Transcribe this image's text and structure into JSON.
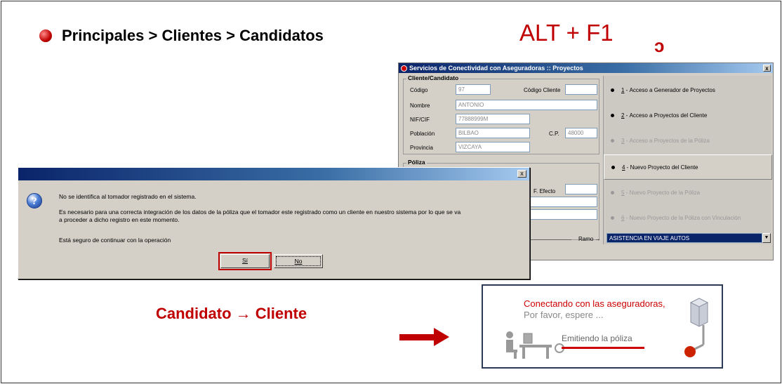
{
  "slide": {
    "breadcrumb": "Principales > Clientes > Candidatos",
    "shortcut": "ALT + F1",
    "transition_label": "Candidato → Cliente"
  },
  "proyectos_window": {
    "title": "Servicios de Conectividad con Aseguradoras :: Proyectos",
    "cliente_group": "Cliente/Candidato",
    "fields": {
      "codigo_label": "Código",
      "codigo_value": "97",
      "codigo_cliente_label": "Código Cliente",
      "codigo_cliente_value": "",
      "nombre_label": "Nombre",
      "nombre_value": "ANTONIO",
      "nif_label": "NIF/CIF",
      "nif_value": "77888999M",
      "poblacion_label": "Población",
      "poblacion_value": "BILBAO",
      "cp_label": "C.P.",
      "cp_value": "48000",
      "provincia_label": "Provincia",
      "provincia_value": "VIZCAYA"
    },
    "poliza_group": "Póliza",
    "f_efecto_label": "F. Efecto",
    "ramo_label": "Ramo",
    "ramo_value": "ASISTENCIA EN VIAJE AUTOS",
    "menu": [
      {
        "num": "1",
        "label": "Acceso a Generador de Proyectos",
        "enabled": true
      },
      {
        "num": "2",
        "label": "Acceso a Proyectos del Cliente",
        "enabled": true
      },
      {
        "num": "3",
        "label": "Acceso a Proyectos de la Póliza",
        "enabled": false
      },
      {
        "num": "4",
        "label": "Nuevo Proyecto del Cliente",
        "enabled": true
      },
      {
        "num": "5",
        "label": "Nuevo Proyecto de la Póliza",
        "enabled": false
      },
      {
        "num": "6",
        "label": "Nuevo Proyecto de la Póliza con Vinculación",
        "enabled": false
      }
    ]
  },
  "dialog": {
    "line1": "No se identifica al tomador registrado en el sistema.",
    "line2a": "Es necesario para una correcta integración de los datos de la póliza que el tomador este registrado como un cliente en nuestro sistema por lo que se va",
    "line2b": "a proceder a dicho registro en este momento.",
    "line3": "Está seguro de continuar con la operación",
    "yes_button": "Sí",
    "no_button": "No"
  },
  "connecting_panel": {
    "line1": "Conectando con las aseguradoras,",
    "line2": "Por favor, espere ...",
    "status": "Emitiendo la póliza"
  },
  "colors": {
    "accent_red": "#c00000",
    "titlebar_blue": "#0a246a",
    "window_gray": "#d4d0c8"
  }
}
